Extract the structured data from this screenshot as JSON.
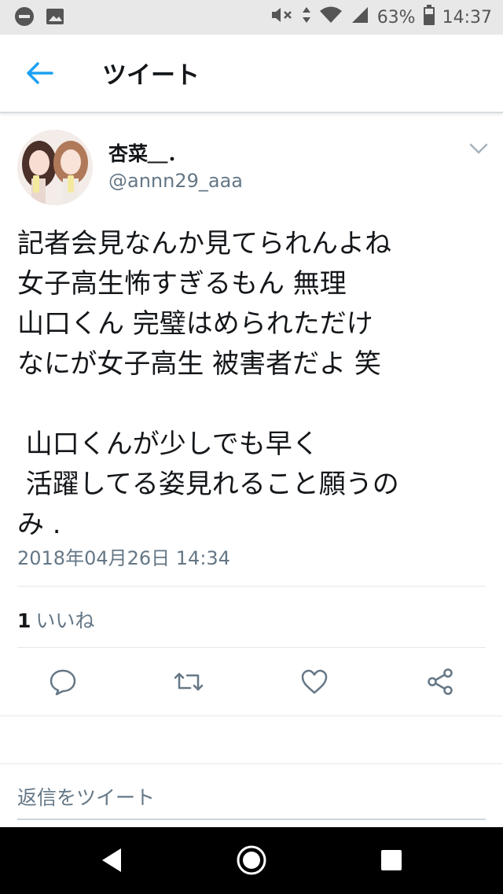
{
  "status_bar": {
    "battery": "63%",
    "time": "14:37"
  },
  "header": {
    "title": "ツイート"
  },
  "tweet": {
    "display_name": "杏菜＿．",
    "handle": "@annn29_aaa",
    "text_lines": [
      "記者会見なんか見てられんよね",
      "女子高生怖すぎるもん 無理",
      "山口くん 完璧はめられただけ",
      "なにが女子高生 被害者だよ 笑",
      "",
      " 山口くんが少しでも早く",
      " 活躍してる姿見れること願うの",
      "み ."
    ],
    "timestamp": "2018年04月26日 14:34",
    "like_count": "1",
    "like_label": "いいね"
  },
  "reply": {
    "placeholder": "返信をツイート"
  },
  "colors": {
    "accent": "#1da1f2",
    "icon_gray": "#657786",
    "text": "#14171a"
  },
  "icons": {
    "back": "arrow-left-icon",
    "caret": "chevron-down-icon",
    "reply": "reply-icon",
    "retweet": "retweet-icon",
    "like": "heart-icon",
    "share": "share-icon"
  }
}
